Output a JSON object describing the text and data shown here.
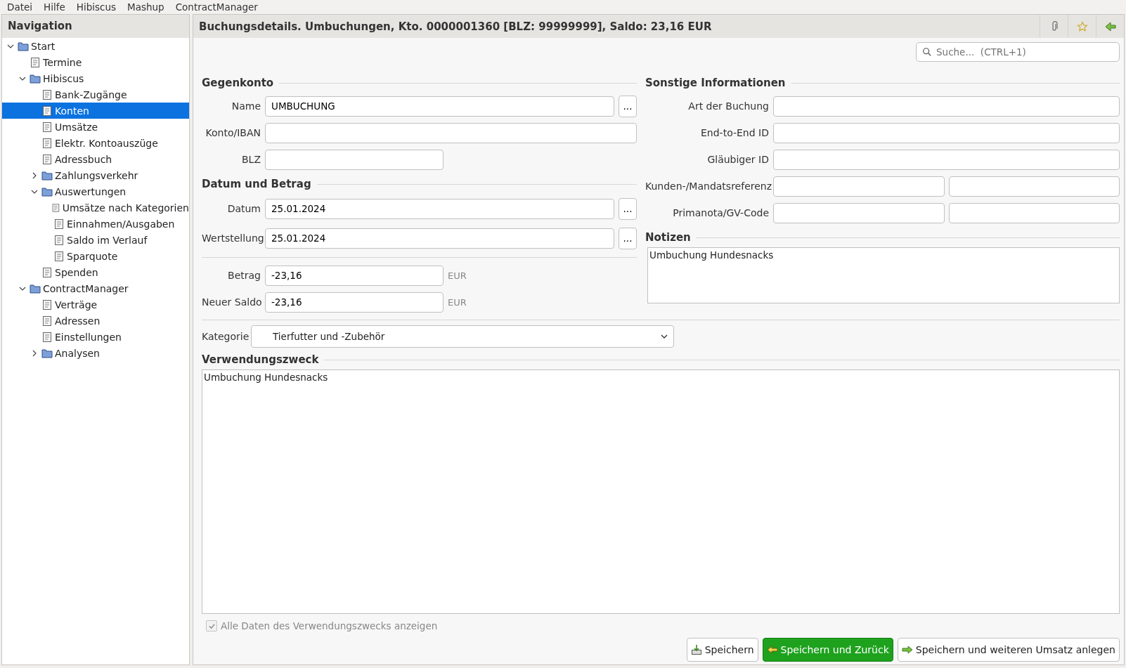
{
  "menu": [
    "Datei",
    "Hilfe",
    "Hibiscus",
    "Mashup",
    "ContractManager"
  ],
  "navigation": {
    "title": "Navigation",
    "items": [
      {
        "label": "Start",
        "expanded": true,
        "selected": false,
        "children": [
          {
            "label": "Termine",
            "selected": false
          },
          {
            "label": "Hibiscus",
            "expanded": true,
            "selected": false,
            "children": [
              {
                "label": "Bank-Zugänge",
                "selected": false
              },
              {
                "label": "Konten",
                "selected": true
              },
              {
                "label": "Umsätze",
                "selected": false
              },
              {
                "label": "Elektr. Kontoauszüge",
                "selected": false
              },
              {
                "label": "Adressbuch",
                "selected": false
              },
              {
                "label": "Zahlungsverkehr",
                "expanded": false,
                "selected": false
              },
              {
                "label": "Auswertungen",
                "expanded": true,
                "selected": false,
                "children": [
                  {
                    "label": "Umsätze nach Kategorien",
                    "selected": false
                  },
                  {
                    "label": "Einnahmen/Ausgaben",
                    "selected": false
                  },
                  {
                    "label": "Saldo im Verlauf",
                    "selected": false
                  },
                  {
                    "label": "Sparquote",
                    "selected": false
                  }
                ]
              },
              {
                "label": "Spenden",
                "selected": false
              }
            ]
          },
          {
            "label": "ContractManager",
            "expanded": true,
            "selected": false,
            "children": [
              {
                "label": "Verträge",
                "selected": false
              },
              {
                "label": "Adressen",
                "selected": false
              },
              {
                "label": "Einstellungen",
                "selected": false
              },
              {
                "label": "Analysen",
                "expanded": false,
                "selected": false
              }
            ]
          }
        ]
      }
    ]
  },
  "header": {
    "title": "Buchungsdetails. Umbuchungen, Kto. 0000001360 [BLZ: 99999999], Saldo: 23,16 EUR"
  },
  "search": {
    "placeholder": "Suche...  (CTRL+1)"
  },
  "gegenkonto": {
    "title": "Gegenkonto",
    "name_label": "Name",
    "name": "UMBUCHUNG",
    "konto_label": "Konto/IBAN",
    "blz_label": "BLZ",
    "more": "..."
  },
  "datum_betrag": {
    "title": "Datum und Betrag",
    "datum_label": "Datum",
    "datum": "25.01.2024",
    "wert_label": "Wertstellung",
    "wert": "25.01.2024",
    "more": "...",
    "betrag_label": "Betrag",
    "betrag": "-23,16",
    "betrag_unit": "EUR",
    "saldo_label": "Neuer Saldo",
    "saldo": "-23,16",
    "saldo_unit": "EUR"
  },
  "sonstige": {
    "title": "Sonstige Informationen",
    "art_label": "Art der Buchung",
    "e2e_label": "End-to-End ID",
    "glaeubiger_label": "Gläubiger ID",
    "kunden_label": "Kunden-/Mandatsreferenz",
    "primanota_label": "Primanota/GV-Code"
  },
  "notizen": {
    "title": "Notizen",
    "text": "Umbuchung Hundesnacks"
  },
  "kategorie": {
    "label": "Kategorie",
    "value": "Tierfutter und -Zubehör"
  },
  "verwendungszweck": {
    "title": "Verwendungszweck",
    "text": "Umbuchung Hundesnacks"
  },
  "show_all": {
    "label": "Alle Daten des Verwendungszwecks anzeigen",
    "checked": true,
    "disabled": true
  },
  "buttons": [
    {
      "label": "Speichern",
      "kind": "save"
    },
    {
      "label": "Speichern und Zurück",
      "kind": "back"
    },
    {
      "label": "Speichern und weiteren Umsatz anlegen",
      "kind": "next"
    }
  ]
}
